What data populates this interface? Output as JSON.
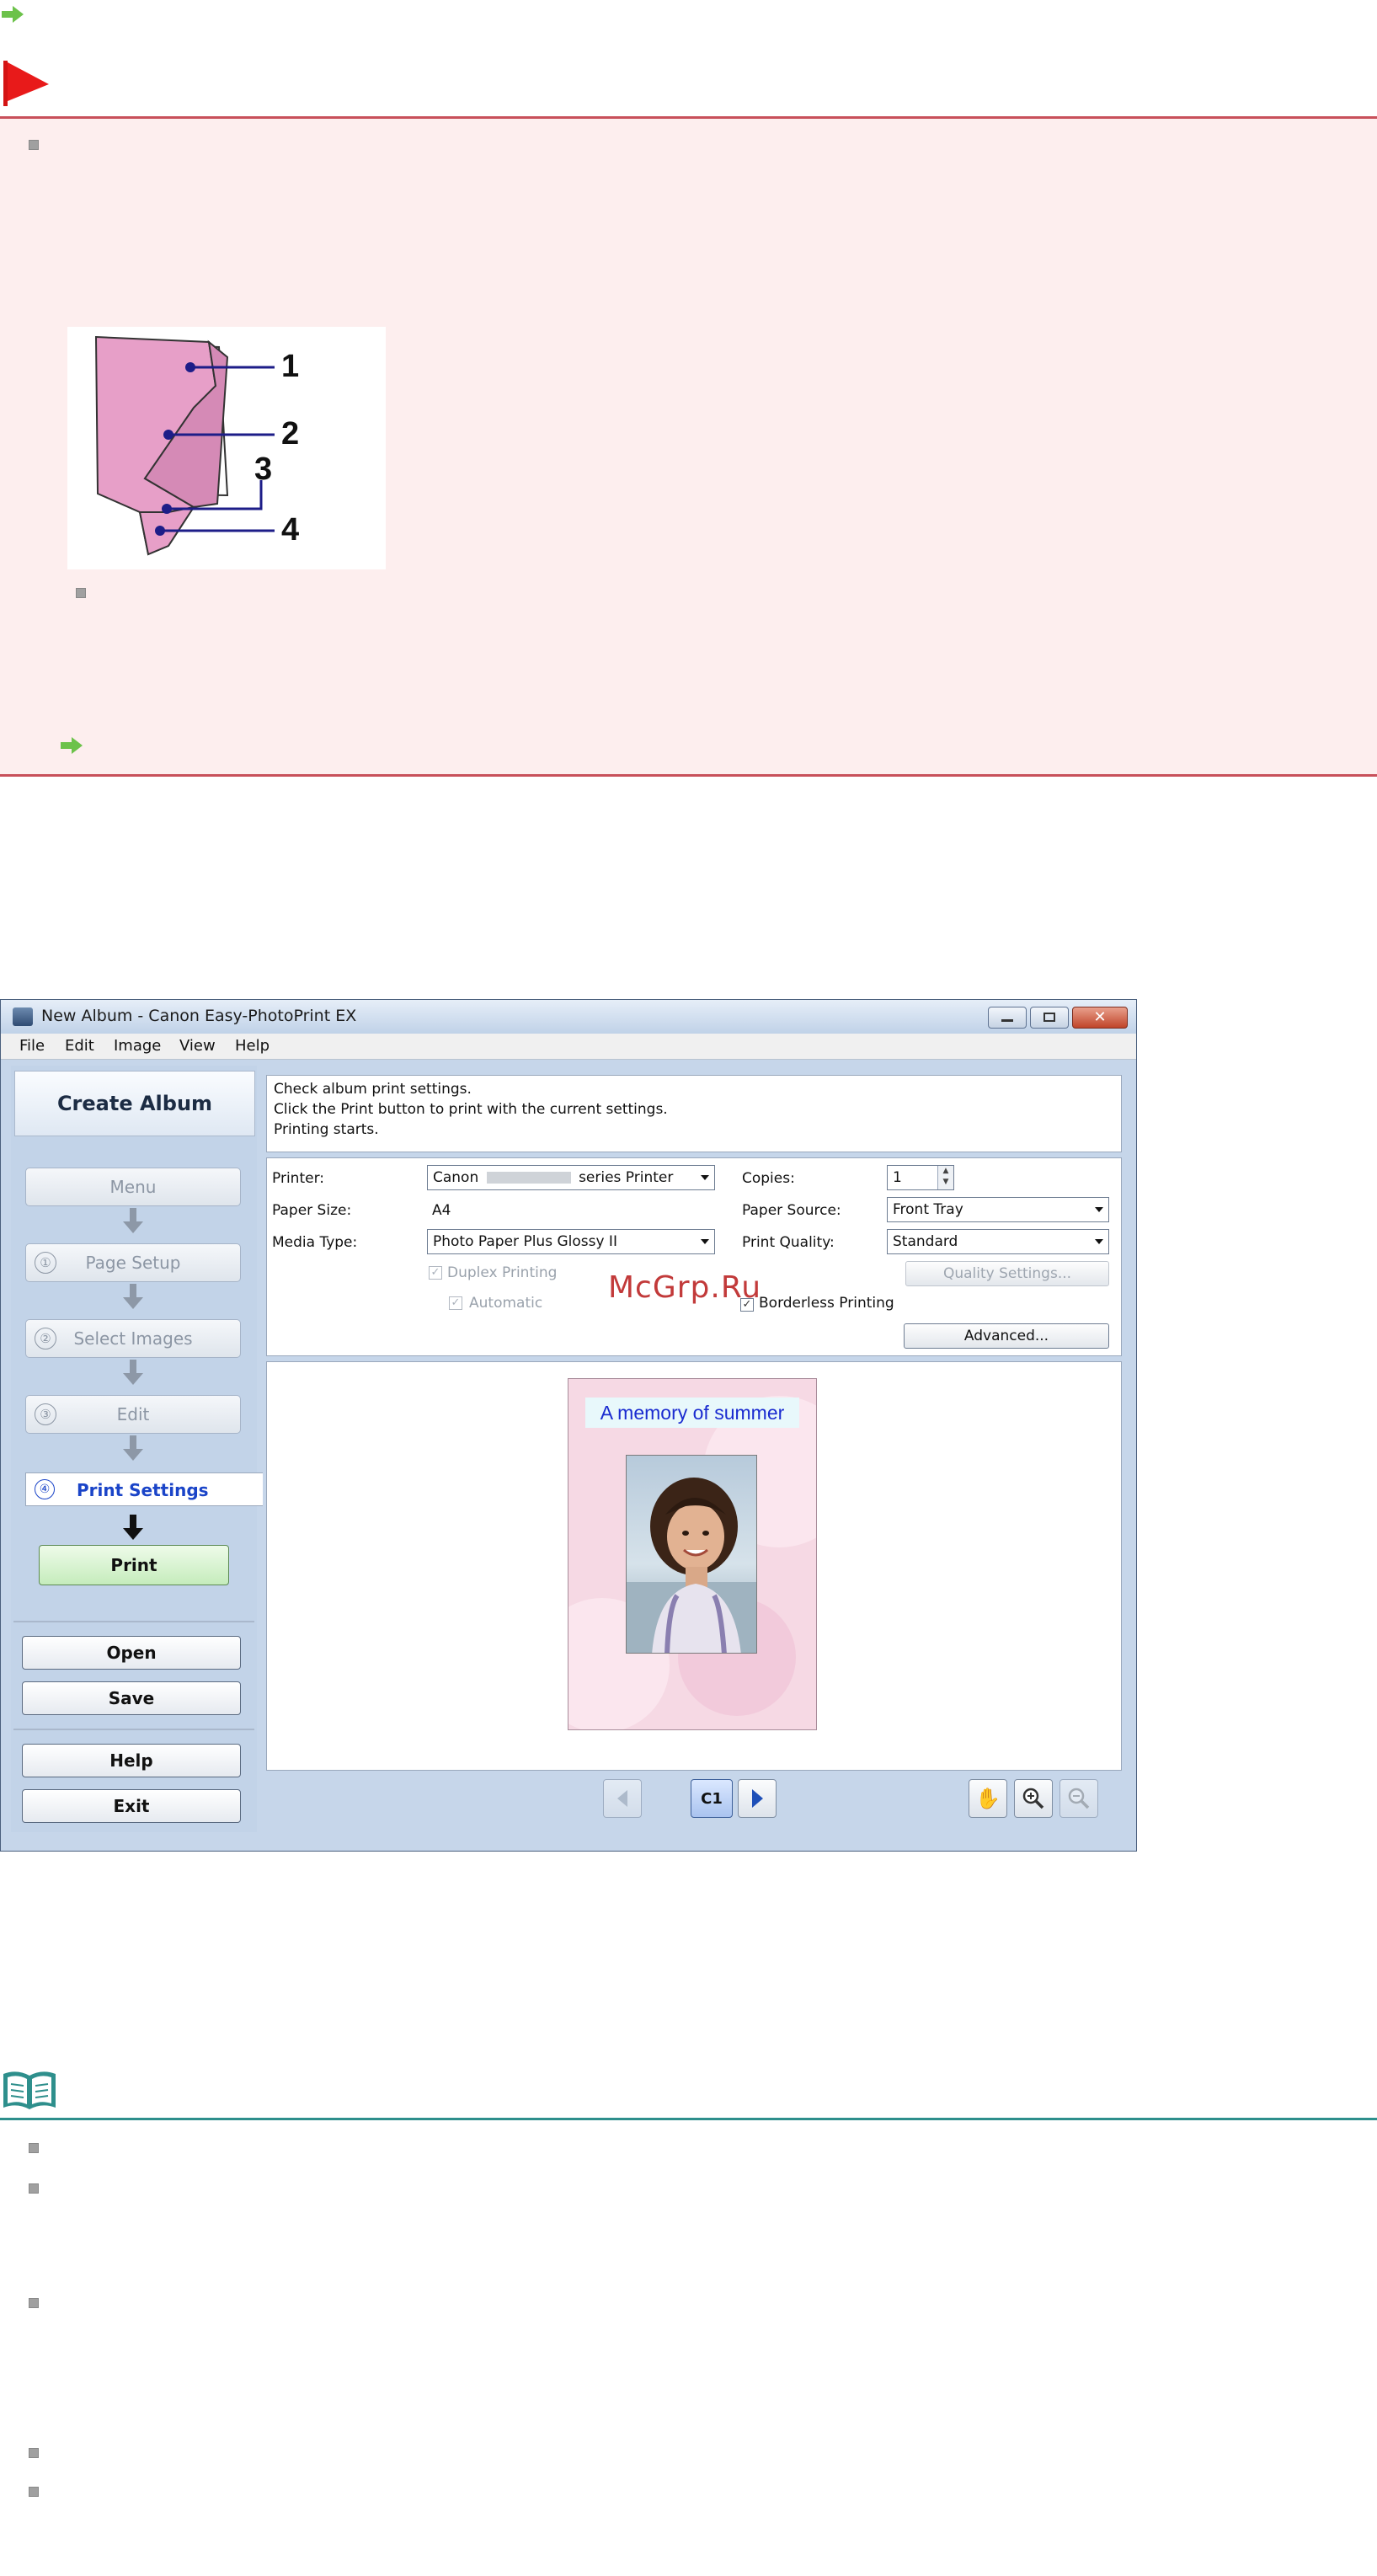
{
  "window": {
    "title": "New Album - Canon Easy-PhotoPrint EX",
    "menu": [
      "File",
      "Edit",
      "Image",
      "View",
      "Help"
    ]
  },
  "left_pane": {
    "heading": "Create Album",
    "steps": [
      {
        "number": "",
        "label": "Menu"
      },
      {
        "number": "①",
        "label": "Page Setup"
      },
      {
        "number": "②",
        "label": "Select Images"
      },
      {
        "number": "③",
        "label": "Edit"
      },
      {
        "number": "④",
        "label": "Print Settings"
      }
    ],
    "buttons": {
      "print": "Print",
      "open": "Open",
      "save": "Save",
      "help": "Help",
      "exit": "Exit"
    }
  },
  "instructions": [
    "Check album print settings.",
    "Click the Print button to print with the current settings.",
    "Printing starts."
  ],
  "settings": {
    "printer_label": "Printer:",
    "printer_value_prefix": "Canon",
    "printer_value_suffix": "series Printer",
    "paper_size_label": "Paper Size:",
    "paper_size_value": "A4",
    "media_type_label": "Media Type:",
    "media_type_value": "Photo Paper Plus Glossy II",
    "copies_label": "Copies:",
    "copies_value": "1",
    "paper_source_label": "Paper Source:",
    "paper_source_value": "Front Tray",
    "print_quality_label": "Print Quality:",
    "print_quality_value": "Standard",
    "duplex_label": "Duplex Printing",
    "automatic_label": "Automatic",
    "borderless_label": "Borderless Printing",
    "quality_settings_button": "Quality Settings...",
    "advanced_button": "Advanced..."
  },
  "preview": {
    "card_title": "A memory of summer",
    "page_indicator": "C1"
  },
  "diagram": {
    "callouts": [
      "1",
      "2",
      "3",
      "4"
    ]
  },
  "watermark": "McGrp.Ru"
}
